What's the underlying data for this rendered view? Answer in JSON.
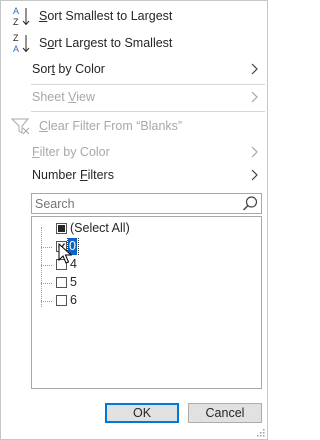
{
  "menu": {
    "sort_asc": {
      "pre": "",
      "mn": "S",
      "post": "ort Smallest to Largest",
      "icon_top": "A",
      "icon_bottom": "Z"
    },
    "sort_desc": {
      "pre": "S",
      "mn": "o",
      "post": "rt Largest to Smallest",
      "icon_top": "Z",
      "icon_bottom": "A"
    },
    "sort_by_color": {
      "pre": "Sor",
      "mn": "t",
      "post": " by Color"
    },
    "sheet_view": {
      "pre": "Sheet ",
      "mn": "V",
      "post": "iew"
    },
    "clear_filter": {
      "pre": "",
      "mn": "C",
      "post": "lear Filter From “Blanks”"
    },
    "filter_by_color": {
      "pre": "",
      "mn": "F",
      "post": "ilter by Color"
    },
    "number_filters": {
      "pre": "Number ",
      "mn": "F",
      "post": "ilters"
    }
  },
  "search": {
    "placeholder": "Search",
    "value": ""
  },
  "list": {
    "items": [
      {
        "label": "(Select All)",
        "state": "mixed"
      },
      {
        "label": "0",
        "state": "checked",
        "selected": true
      },
      {
        "label": "4",
        "state": "unchecked"
      },
      {
        "label": "5",
        "state": "unchecked"
      },
      {
        "label": "6",
        "state": "unchecked"
      }
    ]
  },
  "buttons": {
    "ok": "OK",
    "cancel": "Cancel"
  },
  "colors": {
    "accent": "#0078d7",
    "selection": "#0a64c8",
    "disabled": "#a8a8a8",
    "sort_icon_blue": "#2b6fb6"
  }
}
